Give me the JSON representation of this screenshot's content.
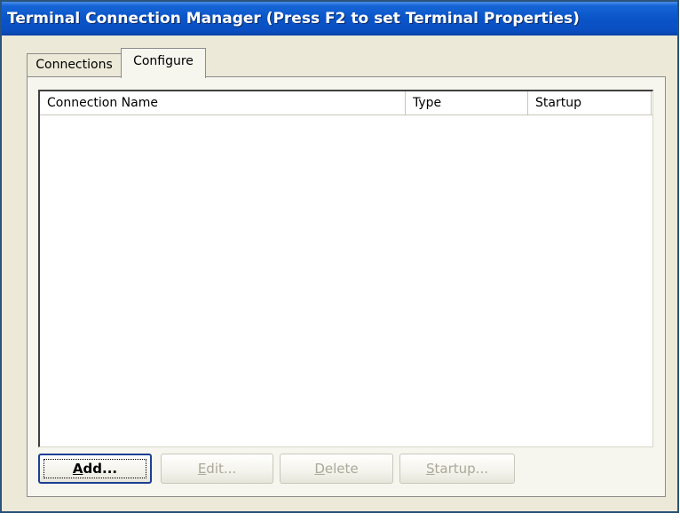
{
  "window": {
    "title": "Terminal Connection Manager (Press F2 to set Terminal Properties)"
  },
  "tabs": [
    {
      "label": "Connections",
      "active": false
    },
    {
      "label": "Configure",
      "active": true
    }
  ],
  "list": {
    "columns": [
      "Connection Name",
      "Type",
      "Startup"
    ],
    "rows": []
  },
  "buttons": {
    "add": {
      "mnemonic": "A",
      "rest": "dd...",
      "enabled": true
    },
    "edit": {
      "mnemonic": "E",
      "rest": "dit...",
      "enabled": false
    },
    "delete": {
      "mnemonic": "D",
      "rest": "elete",
      "enabled": false
    },
    "startup": {
      "mnemonic": "S",
      "rest": "tartup...",
      "enabled": false
    }
  },
  "colors": {
    "titlebar": "#0a54c8",
    "window_bg": "#ece9d8",
    "disabled_text": "#aca899"
  }
}
